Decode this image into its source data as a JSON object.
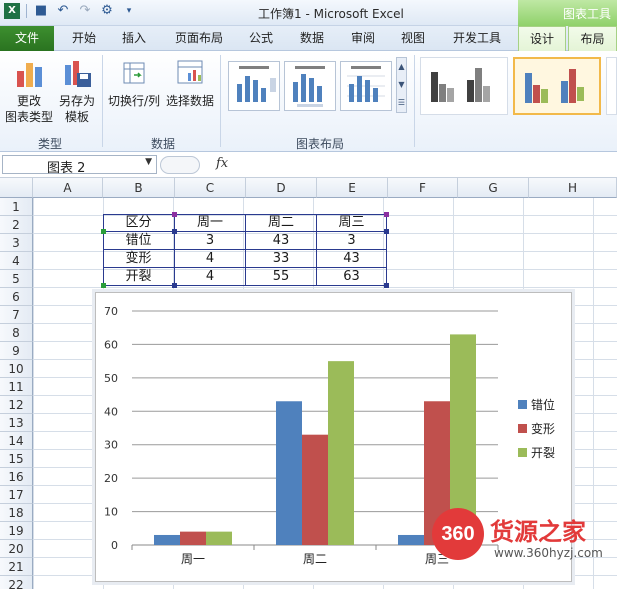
{
  "window": {
    "title": "工作簿1 - Microsoft Excel",
    "context_tab_group": "图表工具"
  },
  "ribbon": {
    "tabs": [
      "文件",
      "开始",
      "插入",
      "页面布局",
      "公式",
      "数据",
      "审阅",
      "视图",
      "开发工具",
      "设计",
      "布局"
    ],
    "active_tab": "设计",
    "groups": {
      "type": {
        "label": "类型",
        "change_type_label": "更改\n图表类型",
        "save_template_label": "另存为\n模板"
      },
      "data": {
        "label": "数据",
        "switch_row_col_label": "切换行/列",
        "select_data_label": "选择数据"
      },
      "layout": {
        "label": "图表布局"
      }
    }
  },
  "formula_bar": {
    "name_box": "图表 2",
    "fx_label": "fx",
    "formula": ""
  },
  "sheet": {
    "columns": [
      "A",
      "B",
      "C",
      "D",
      "E",
      "F",
      "G",
      "H"
    ],
    "rows": [
      "1",
      "2",
      "3",
      "4",
      "5",
      "6",
      "7",
      "8",
      "9",
      "10",
      "11",
      "12",
      "13",
      "14",
      "15",
      "16",
      "17",
      "18",
      "19",
      "20",
      "21",
      "22"
    ],
    "table": {
      "header": [
        "区分",
        "周一",
        "周二",
        "周三"
      ],
      "rows": [
        [
          "错位",
          "3",
          "43",
          "3"
        ],
        [
          "变形",
          "4",
          "33",
          "43"
        ],
        [
          "开裂",
          "4",
          "55",
          "63"
        ]
      ]
    }
  },
  "chart_data": {
    "type": "bar",
    "categories": [
      "周一",
      "周二",
      "周三"
    ],
    "series": [
      {
        "name": "错位",
        "values": [
          3,
          43,
          3
        ],
        "color": "#4f81bd"
      },
      {
        "name": "变形",
        "values": [
          4,
          33,
          43
        ],
        "color": "#c0504d"
      },
      {
        "name": "开裂",
        "values": [
          4,
          55,
          63
        ],
        "color": "#9bbb59"
      }
    ],
    "ylim": [
      0,
      70
    ],
    "yticks": [
      0,
      10,
      20,
      30,
      40,
      50,
      60,
      70
    ],
    "grid": true,
    "legend": "right"
  },
  "watermark": {
    "badge": "360",
    "title": "货源之家",
    "url": "www.360hyzj.com"
  },
  "colors": {
    "file_tab": "#2a7320",
    "context_tab": "#8fd16a",
    "table_border": "#2a3a8f"
  }
}
